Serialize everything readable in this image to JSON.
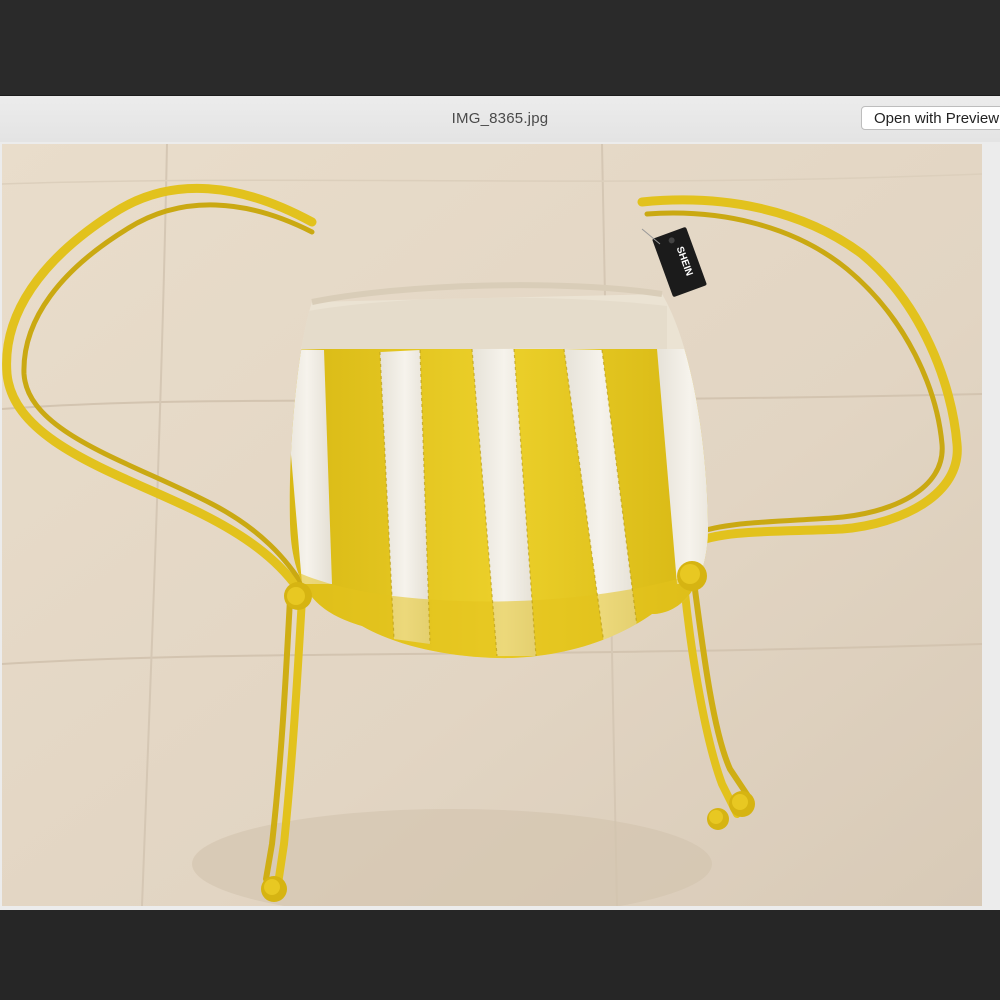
{
  "window": {
    "title": "IMG_8365.jpg",
    "open_button_label": "Open with Preview"
  },
  "photo": {
    "tag_text": "SHEIN",
    "colors": {
      "blanket": "#e3d7c6",
      "canvas": "#ebe3d3",
      "stripe_yellow": "#e2c51e",
      "stripe_white": "#f1eee6",
      "strap": "#e8c520",
      "tag": "#1b1b1b"
    }
  }
}
